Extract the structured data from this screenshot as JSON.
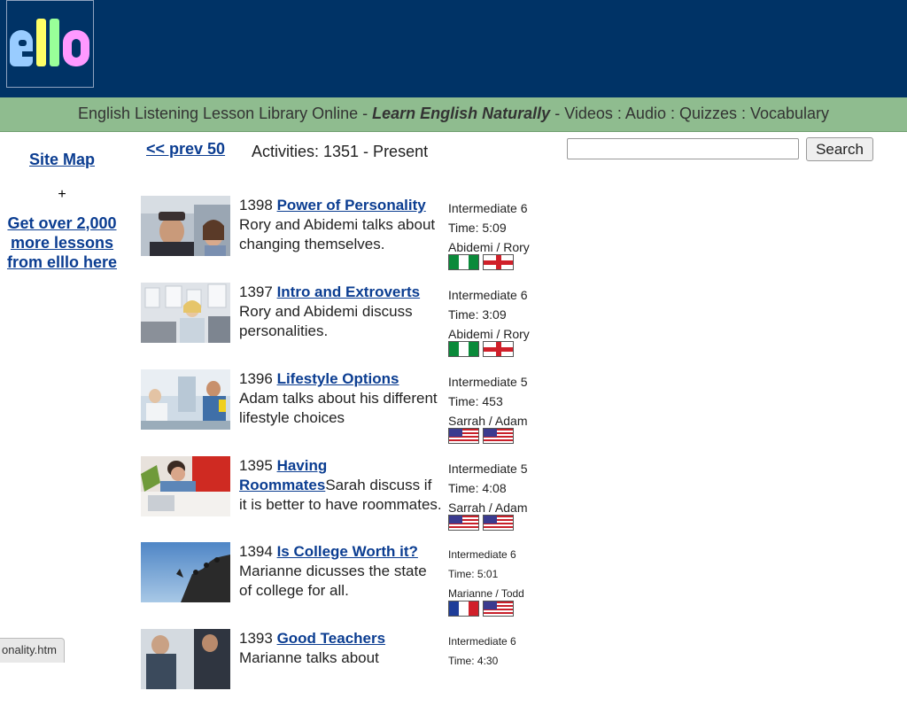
{
  "tagline": {
    "prefix": "English Listening Lesson Library Online - ",
    "emphasis": "Learn English Naturally",
    "suffix": " - Videos : Audio : Quizzes : Vocabulary"
  },
  "sidebar": {
    "site_map": "Site Map",
    "plus": "+",
    "get_more": "Get over 2,000 more lessons from elllo here"
  },
  "nav": {
    "prev": "<< prev 50",
    "activities": "Activities: 1351 - Present"
  },
  "search": {
    "placeholder": "",
    "button": "Search"
  },
  "lessons": [
    {
      "num": "1398",
      "title": "Power of Personality",
      "desc": "Rory and Abidemi talks about changing themselves.",
      "level": "Intermediate 6",
      "time": "Time: 5:09",
      "speakers": "Abidemi / Rory",
      "flags": [
        "ng",
        "en"
      ]
    },
    {
      "num": "1397",
      "title": "Intro and Extroverts",
      "desc": "Rory and Abidemi discuss personalities.",
      "level": "Intermediate 6",
      "time": "Time: 3:09",
      "speakers": "Abidemi / Rory",
      "flags": [
        "ng",
        "en"
      ]
    },
    {
      "num": "1396",
      "title": "Lifestyle Options",
      "desc": "Adam talks about his different lifestyle choices",
      "level": "Intermediate 5",
      "time": "Time: 453",
      "speakers": "Sarrah / Adam",
      "flags": [
        "us",
        "us"
      ]
    },
    {
      "num": "1395",
      "title": "Having Roommates",
      "desc": "Sarah discuss if it is better to have roommates.",
      "level": "Intermediate 5",
      "time": "Time: 4:08",
      "speakers": "Sarrah / Adam",
      "flags": [
        "us",
        "us"
      ]
    },
    {
      "num": "1394",
      "title": "Is College Worth it?",
      "desc": "Marianne dicusses the state of college for all.",
      "level": "Intermediate 6",
      "time": "Time: 5:01",
      "speakers": "Marianne / Todd",
      "flags": [
        "fr",
        "us"
      ]
    },
    {
      "num": "1393",
      "title": "Good Teachers",
      "desc": "Marianne talks about",
      "level": "Intermediate 6",
      "time": "Time: 4:30",
      "speakers": "",
      "flags": []
    }
  ],
  "status_url": "onality.htm"
}
